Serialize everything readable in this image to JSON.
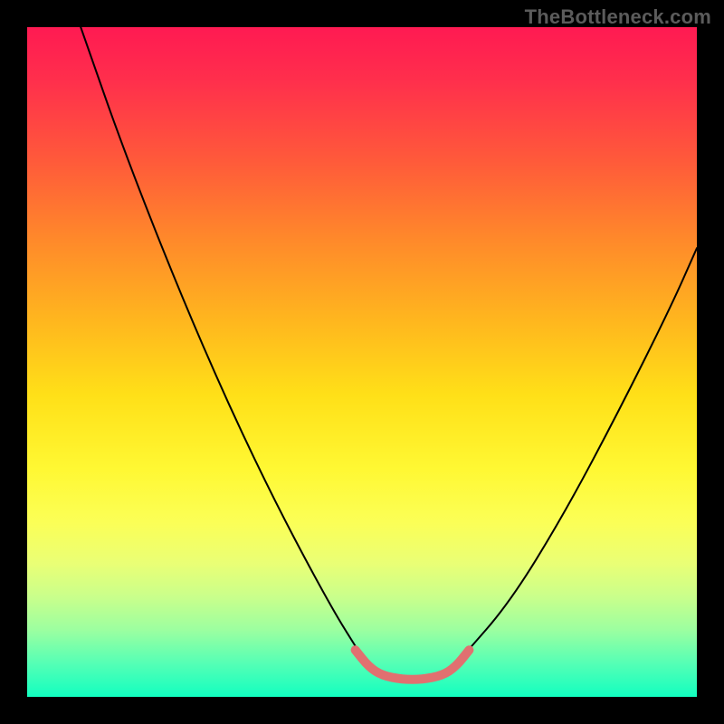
{
  "watermark": "TheBottleneck.com",
  "chart_data": {
    "type": "line",
    "title": "",
    "xlabel": "",
    "ylabel": "",
    "xlim": [
      0,
      100
    ],
    "ylim": [
      0,
      100
    ],
    "gradient_stops": [
      {
        "pos": 0,
        "color": "#ff1a52"
      },
      {
        "pos": 8,
        "color": "#ff2f4c"
      },
      {
        "pos": 20,
        "color": "#ff5a3a"
      },
      {
        "pos": 32,
        "color": "#ff8a2a"
      },
      {
        "pos": 44,
        "color": "#ffb71e"
      },
      {
        "pos": 55,
        "color": "#ffe018"
      },
      {
        "pos": 66,
        "color": "#fff833"
      },
      {
        "pos": 74,
        "color": "#fbff57"
      },
      {
        "pos": 80,
        "color": "#eaff75"
      },
      {
        "pos": 85,
        "color": "#caff8b"
      },
      {
        "pos": 90,
        "color": "#9cffa0"
      },
      {
        "pos": 95,
        "color": "#55ffb5"
      },
      {
        "pos": 100,
        "color": "#12ffc0"
      }
    ],
    "series": [
      {
        "name": "bottleneck-curve-left",
        "color": "#000000",
        "width": 2,
        "points": [
          {
            "x": 8,
            "y": 100
          },
          {
            "x": 15,
            "y": 80
          },
          {
            "x": 25,
            "y": 55
          },
          {
            "x": 35,
            "y": 33
          },
          {
            "x": 45,
            "y": 14
          },
          {
            "x": 50,
            "y": 6
          }
        ]
      },
      {
        "name": "bottleneck-curve-right",
        "color": "#000000",
        "width": 2,
        "points": [
          {
            "x": 65,
            "y": 6
          },
          {
            "x": 72,
            "y": 14
          },
          {
            "x": 80,
            "y": 27
          },
          {
            "x": 88,
            "y": 42
          },
          {
            "x": 96,
            "y": 58
          },
          {
            "x": 100,
            "y": 67
          }
        ]
      },
      {
        "name": "trough-highlight",
        "color": "#e17070",
        "width": 10,
        "points": [
          {
            "x": 49,
            "y": 7
          },
          {
            "x": 51,
            "y": 4.5
          },
          {
            "x": 53,
            "y": 3.2
          },
          {
            "x": 56,
            "y": 2.6
          },
          {
            "x": 59,
            "y": 2.6
          },
          {
            "x": 62,
            "y": 3.2
          },
          {
            "x": 64,
            "y": 4.5
          },
          {
            "x": 66,
            "y": 7
          }
        ]
      }
    ]
  }
}
